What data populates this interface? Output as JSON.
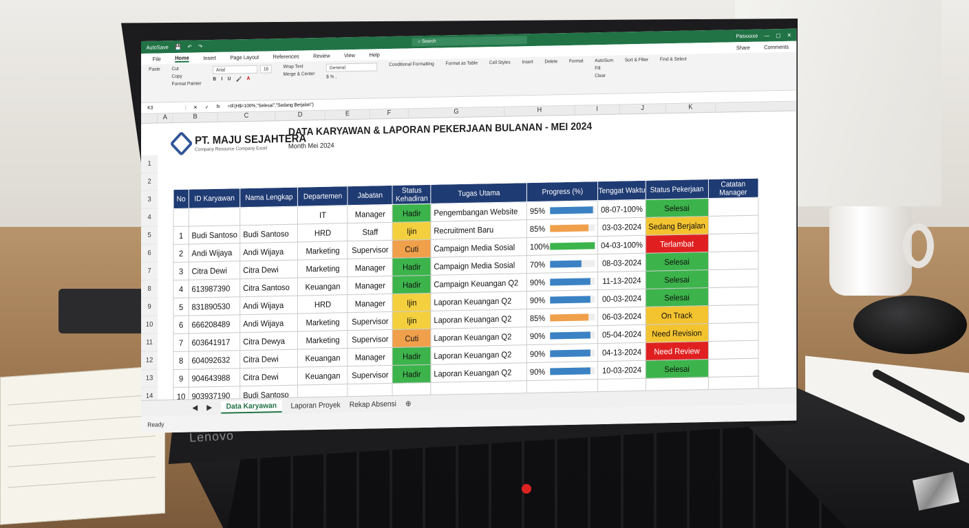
{
  "titlebar": {
    "autosave": "AutoSave",
    "search": "Search",
    "user": "Pasxxxxe"
  },
  "menu": [
    "File",
    "Home",
    "Insert",
    "Page Layout",
    "References",
    "Review",
    "View",
    "Help"
  ],
  "ribbon": {
    "paste": "Paste",
    "cut": "Cut",
    "copy": "Copy",
    "format_painter": "Format Painter",
    "font": "Arial",
    "size": "16",
    "wrap": "Wrap Text",
    "merge": "Merge & Center",
    "number_format": "General",
    "conditional": "Conditional Formatting",
    "format_table": "Format as Table",
    "cell_styles": "Cell Styles",
    "insert": "Insert",
    "delete": "Delete",
    "format": "Format",
    "autosum": "AutoSum",
    "fill": "Fill",
    "clear": "Clear",
    "sort": "Sort & Filter",
    "find": "Find & Select",
    "share": "Share",
    "comments": "Comments"
  },
  "formula": {
    "cell": "K3",
    "fx": "fx",
    "content": "=IF(H$=100%,\"Selesai\",\"Sedang Berjalan\")"
  },
  "columns": [
    "A",
    "B",
    "C",
    "D",
    "E",
    "F",
    "G",
    "H",
    "I",
    "J",
    "K"
  ],
  "header": {
    "company": "PT. MAJU SEJAHTERA",
    "tagline": "Company Resource Company Excel",
    "title": "DATA KARYAWAN & LAPORAN PEKERJAAN BULANAN - MEI 2024",
    "subtitle": "Month Mei 2024"
  },
  "table": {
    "headers": [
      "No",
      "ID Karyawan",
      "Nama Lengkap",
      "Departemen",
      "Jabatan",
      "Status Kehadiran",
      "Tugas Utama",
      "Progress (%)",
      "Tenggat Waktu",
      "Status Pekerjaan",
      "Catatan Manager"
    ],
    "rows": [
      {
        "no": "",
        "id": "",
        "name": "",
        "dept": "IT",
        "role": "Manager",
        "att": "Hadir",
        "task": "Pengembangan Website",
        "prog": "95%",
        "p": 0.95,
        "due": "08-07-100%",
        "status": "Selesai"
      },
      {
        "no": "1",
        "id": "Budi Santoso",
        "name": "Budi Santoso",
        "dept": "HRD",
        "role": "Staff",
        "att": "Ijin",
        "task": "Recruitment Baru",
        "prog": "85%",
        "p": 0.85,
        "due": "03-03-2024",
        "status": "Sedang Berjalan"
      },
      {
        "no": "2",
        "id": "Andi Wijaya",
        "name": "Andi Wijaya",
        "dept": "Marketing",
        "role": "Supervisor",
        "att": "Cuti",
        "task": "Campaign Media Sosial",
        "prog": "100%",
        "p": 1.0,
        "due": "04-03-100%",
        "status": "Terlambat"
      },
      {
        "no": "3",
        "id": "Citra Dewi",
        "name": "Citra Dewi",
        "dept": "Marketing",
        "role": "Manager",
        "att": "Hadir",
        "task": "Campaign Media Sosial",
        "prog": "70%",
        "p": 0.7,
        "due": "08-03-2024",
        "status": "Selesai"
      },
      {
        "no": "4",
        "id": "613987390",
        "name": "Citra Santoso",
        "dept": "Keuangan",
        "role": "Manager",
        "att": "Hadir",
        "task": "Campaign Keuangan Q2",
        "prog": "90%",
        "p": 0.9,
        "due": "11-13-2024",
        "status": "Selesai"
      },
      {
        "no": "5",
        "id": "831890530",
        "name": "Andi Wijaya",
        "dept": "HRD",
        "role": "Manager",
        "att": "Ijin",
        "task": "Laporan Keuangan Q2",
        "prog": "90%",
        "p": 0.9,
        "due": "00-03-2024",
        "status": "Selesai"
      },
      {
        "no": "6",
        "id": "666208489",
        "name": "Andi Wijaya",
        "dept": "Marketing",
        "role": "Supervisor",
        "att": "Ijin",
        "task": "Laporan Keuangan Q2",
        "prog": "85%",
        "p": 0.85,
        "due": "06-03-2024",
        "status": "On Track"
      },
      {
        "no": "7",
        "id": "603641917",
        "name": "Citra Dewya",
        "dept": "Marketing",
        "role": "Supervisor",
        "att": "Cuti",
        "task": "Laporan Keuangan Q2",
        "prog": "90%",
        "p": 0.9,
        "due": "05-04-2024",
        "status": "Need Revision"
      },
      {
        "no": "8",
        "id": "604092632",
        "name": "Citra Dewi",
        "dept": "Keuangan",
        "role": "Manager",
        "att": "Hadir",
        "task": "Laporan Keuangan Q2",
        "prog": "90%",
        "p": 0.9,
        "due": "04-13-2024",
        "status": "Need Review"
      },
      {
        "no": "9",
        "id": "904643988",
        "name": "Citra Dewi",
        "dept": "Keuangan",
        "role": "Supervisor",
        "att": "Hadir",
        "task": "Laporan Keuangan Q2",
        "prog": "90%",
        "p": 0.9,
        "due": "10-03-2024",
        "status": "Selesai"
      },
      {
        "no": "10",
        "id": "903937190",
        "name": "Budi Santoso",
        "dept": "",
        "role": "",
        "att": "",
        "task": "",
        "prog": "",
        "p": 0,
        "due": "",
        "status": ""
      }
    ]
  },
  "colors": {
    "excel_green": "#217346",
    "header_blue": "#1f3b73",
    "hadir": "#3cb44b",
    "ijin": "#f4d03f",
    "cuti": "#f0a04b",
    "selesai": "#3cb44b",
    "berjalan": "#f4c430",
    "terlambat": "#e02020",
    "review": "#e02020"
  },
  "tabs": [
    "Data Karyawan",
    "Laporan Proyek",
    "Rekap Absensi"
  ],
  "status_bar": "Ready",
  "brand": "Lenovo"
}
